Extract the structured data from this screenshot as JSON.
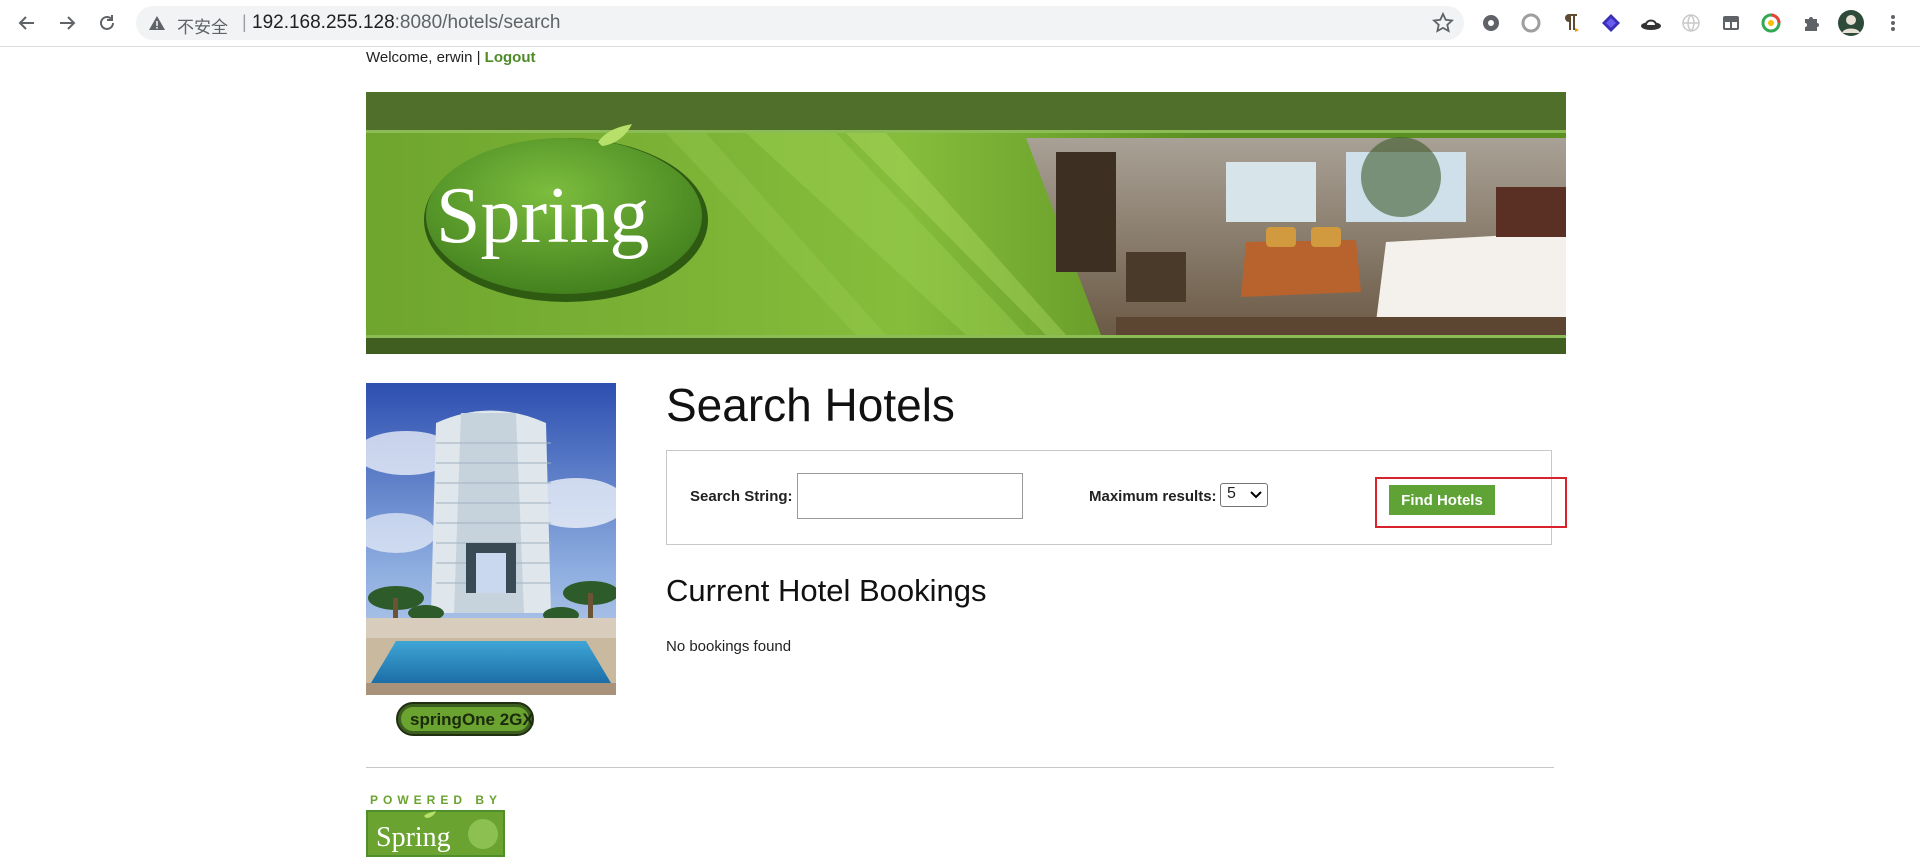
{
  "browser": {
    "security_label": "不安全",
    "separator": "|",
    "url_host": "192.168.255.128",
    "url_rest": ":8080/hotels/search",
    "icons": [
      "back-icon",
      "forward-icon",
      "reload-icon",
      "warning-icon",
      "star-icon",
      "extension-icons",
      "profile-avatar",
      "menu-icon"
    ]
  },
  "header": {
    "welcome_prefix": "Welcome, erwin |",
    "logout_label": "Logout",
    "banner_logo_text": "Spring"
  },
  "sidebar": {
    "springone_text": "springOne 2GX",
    "powered_by": "POWERED BY",
    "powered_logo": "Spring"
  },
  "main": {
    "title": "Search Hotels",
    "search": {
      "label": "Search String:",
      "value": "",
      "placeholder": ""
    },
    "max_results": {
      "label": "Maximum results:",
      "selected": "5"
    },
    "find_button": "Find Hotels",
    "bookings_title": "Current Hotel Bookings",
    "bookings_empty": "No bookings found"
  },
  "colors": {
    "brand_green": "#5fa236",
    "link_green": "#4e8a28",
    "highlight_red": "#d9232c"
  }
}
